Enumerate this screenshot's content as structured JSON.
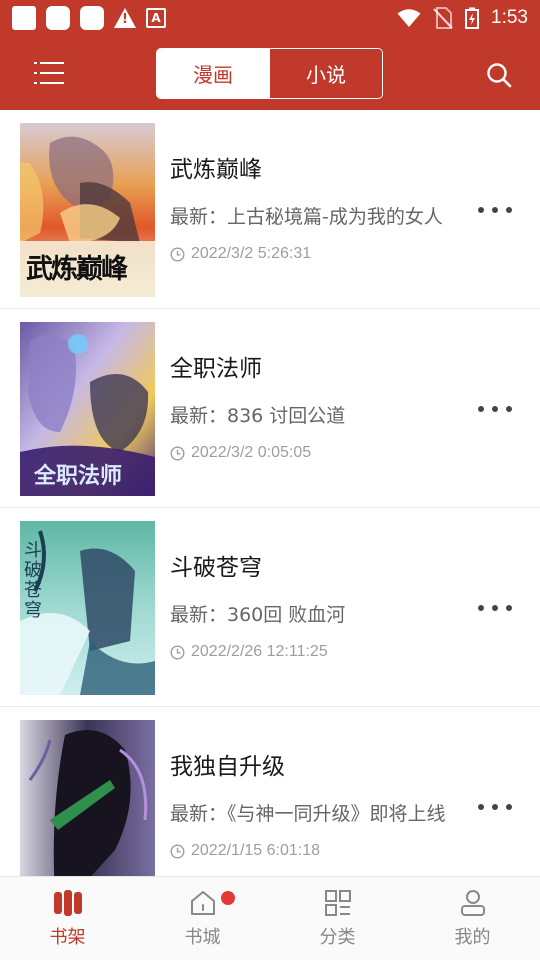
{
  "status_bar": {
    "time": "1:53",
    "icons": [
      "notification-square-icon",
      "notification-square-icon",
      "notification-square-icon",
      "warning-icon",
      "accessibility-icon",
      "wifi-icon",
      "no-sim-icon",
      "battery-charging-icon"
    ]
  },
  "app_bar": {
    "tabs": [
      {
        "label": "漫画",
        "active": true
      },
      {
        "label": "小说",
        "active": false
      }
    ],
    "icons": {
      "menu": "menu-icon",
      "search": "search-icon"
    }
  },
  "shelf": {
    "items": [
      {
        "title": "武炼巅峰",
        "latest": "最新：上古秘境篇-成为我的女人",
        "updated": "2022/3/2 5:26:31",
        "cover_text": "武炼巅峰"
      },
      {
        "title": "全职法师",
        "latest": "最新：836 讨回公道",
        "updated": "2022/3/2 0:05:05",
        "cover_text": "全职法师"
      },
      {
        "title": "斗破苍穹",
        "latest": "最新：360回 败血河",
        "updated": "2022/2/26 12:11:25",
        "cover_text": "斗破苍穹"
      },
      {
        "title": "我独自升级",
        "latest": "最新：《与神一同升级》即将上线",
        "updated": "2022/1/15 6:01:18",
        "cover_text": ""
      }
    ]
  },
  "bottom_nav": {
    "items": [
      {
        "label": "书架",
        "icon": "bookshelf-icon",
        "active": true
      },
      {
        "label": "书城",
        "icon": "home-icon",
        "active": false,
        "badge": true
      },
      {
        "label": "分类",
        "icon": "grid-icon",
        "active": false
      },
      {
        "label": "我的",
        "icon": "user-icon",
        "active": false
      }
    ]
  },
  "colors": {
    "primary": "#c0392b",
    "badge": "#e53935",
    "text_dark": "#1a1a1a",
    "text_gray": "#666666",
    "text_light": "#9e9e9e"
  }
}
